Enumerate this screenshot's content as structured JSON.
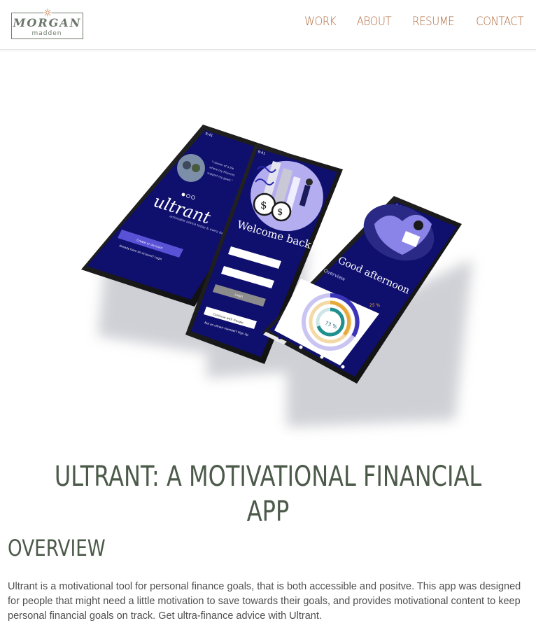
{
  "logo": {
    "name": "MORGAN",
    "sub": "madden"
  },
  "nav": [
    {
      "label": "WORK"
    },
    {
      "label": "ABOUT"
    },
    {
      "label": "RESUME"
    },
    {
      "label": "CONTACT"
    }
  ],
  "mockup": {
    "left_phone": {
      "time": "9:41",
      "brand": "ultrant",
      "tagline": "actionable advice today & every day",
      "cta": "Create an Account",
      "login_prompt": "Already have an account? Login"
    },
    "middle_phone": {
      "time": "9:41",
      "heading": "Welcome back!",
      "login_button": "Login",
      "google_button": "Continue with Google",
      "signup_prompt": "Not an ultrant member? Sign Up"
    },
    "right_phone": {
      "time": "9:41",
      "heading": "Good afternoon",
      "section": "Overview",
      "percent": "73 %",
      "percent_small": "25 %"
    }
  },
  "page": {
    "title": "ULTRANT: A MOTIVATIONAL FINANCIAL APP",
    "overview_heading": "OVERVIEW",
    "overview_text": "Ultrant is a motivational tool for personal finance goals, that is both accessible and positve. This app was designed for people that might need a little motivation to save towards their goals, and provides motivational content to keep personal financial goals on track. Get ultra-finance advice with Ultrant."
  },
  "colors": {
    "nav": "#b0683a",
    "heading": "#4c5a4a",
    "screen": "#0f0f6e",
    "accent": "#7b6fd6"
  }
}
